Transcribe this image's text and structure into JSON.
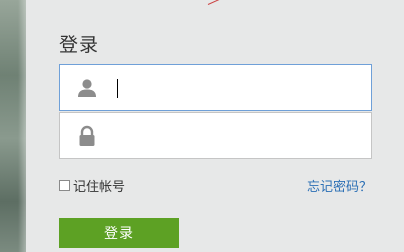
{
  "login": {
    "title": "登录",
    "username_field": {
      "value": "",
      "placeholder": "",
      "icon": "user-icon"
    },
    "password_field": {
      "value": "",
      "placeholder": "",
      "icon": "lock-icon"
    },
    "remember_label": "记住帐号",
    "remember_checked": false,
    "forgot_link": "忘记密码？",
    "submit_label": "登录"
  },
  "colors": {
    "accent_green": "#5da124",
    "link_blue": "#2b6fb5",
    "focus_border": "#6fa0d8",
    "background": "#e7e8e8"
  }
}
